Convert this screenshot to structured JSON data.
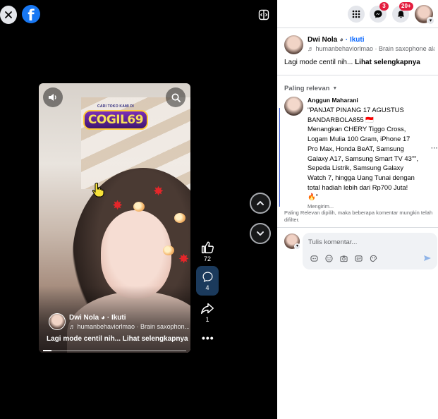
{
  "colors": {
    "brand": "#1877f2",
    "link": "#0866ff",
    "badge": "#e41e3f",
    "viewer_bg": "#000000",
    "panel_bg": "#ffffff"
  },
  "viewer": {
    "close_icon": "close-icon",
    "logo_text": "f",
    "video": {
      "promo_top": "CARI TOKO KAMI DI",
      "promo_main": "COGIL69",
      "author_name": "Dwi Nola",
      "follow_label": "· Ikuti",
      "audio_text": "♬ humanbehaviorlmao · Brain saxophon...",
      "caption": "Lagi mode centil nih...",
      "see_more": "Lihat selengkapnya",
      "progress": 0.06
    },
    "actions": {
      "likes": "72",
      "comments": "4",
      "shares": "1",
      "more": "•••"
    }
  },
  "topbar": {
    "messenger_badge": "3",
    "notifications_badge": "20+"
  },
  "post": {
    "author": "Dwi Nola",
    "follow_label": "· Ikuti",
    "audio_text": "♬ humanbehaviorlmao · Brain saxophone ala...",
    "caption": "Lagi mode centil nih...",
    "see_more": "Lihat selengkapnya"
  },
  "comments": {
    "sort_label": "Paling relevan",
    "items": [
      {
        "author": "Anggun Maharani",
        "text": "\"PANJAT PINANG 17 AGUSTUS\nBANDARBOLA855 🇮🇩\nMenangkan CHERY Tiggo Cross,\nLogam Mulia 100 Gram, iPhone 17\nPro Max, Honda BeAT, Samsung\nGalaxy A17, Samsung Smart TV 43\"\",\nSepeda Listrik, Samsung Galaxy\nWatch 7, hingga Uang Tunai dengan\ntotal hadiah lebih dari Rp700 Juta!\n🔥\"",
        "status": "Mengirim..."
      }
    ],
    "notice": "Paling Relevan dipilih, maka beberapa komentar mungkin telah difilter.",
    "composer_placeholder": "Tulis komentar..."
  }
}
